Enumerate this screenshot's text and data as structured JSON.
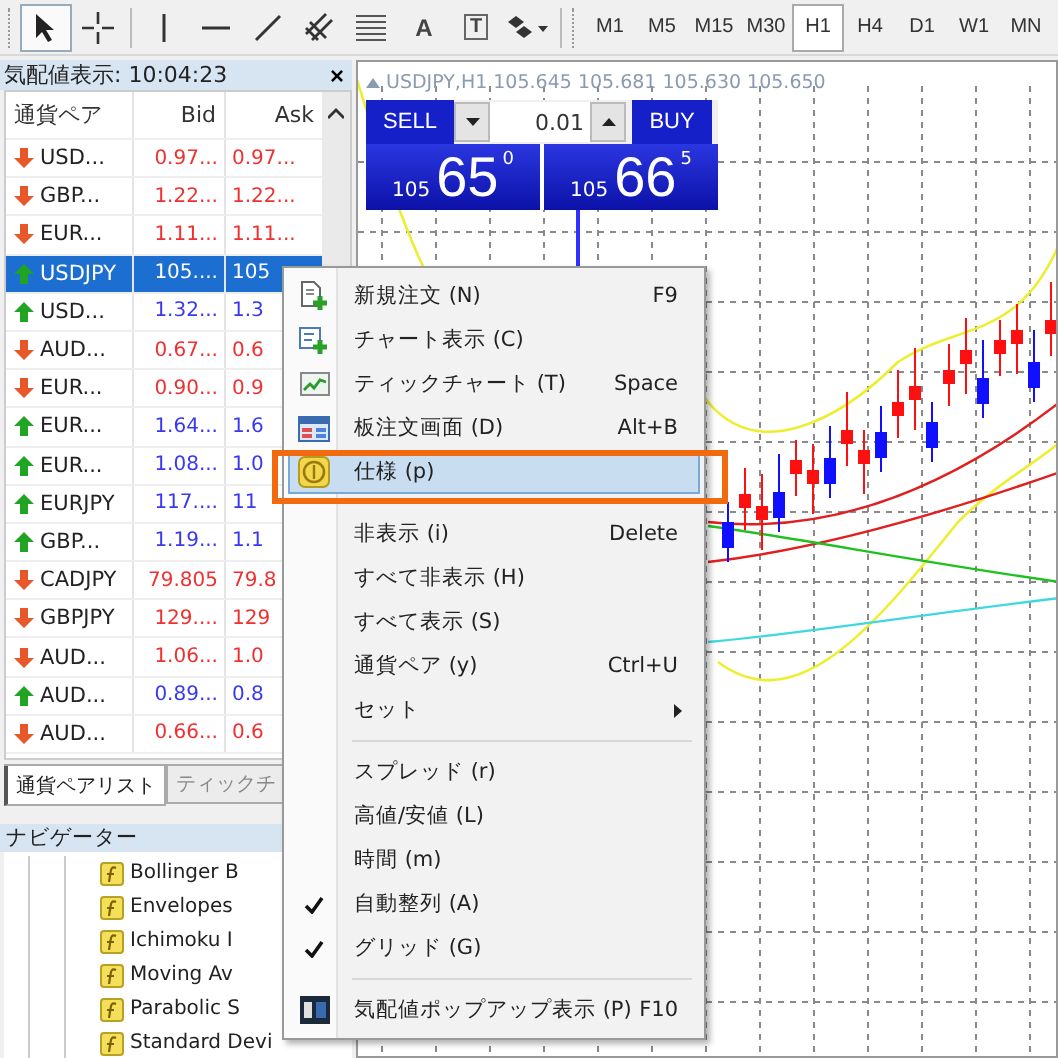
{
  "toolbar": {
    "tools": [
      {
        "kind": "cursor",
        "selected": true
      },
      {
        "kind": "crosshair",
        "selected": false
      },
      {
        "kind": "vline",
        "selected": false
      },
      {
        "kind": "hline",
        "selected": false
      },
      {
        "kind": "trendline",
        "selected": false
      },
      {
        "kind": "channel",
        "selected": false
      },
      {
        "kind": "fibo",
        "selected": false
      },
      {
        "kind": "text",
        "label": "A",
        "selected": false
      },
      {
        "kind": "label",
        "label": "T",
        "selected": false
      },
      {
        "kind": "shapes",
        "selected": false
      }
    ],
    "timeframes": [
      {
        "label": "M1",
        "selected": false
      },
      {
        "label": "M5",
        "selected": false
      },
      {
        "label": "M15",
        "selected": false
      },
      {
        "label": "M30",
        "selected": false
      },
      {
        "label": "H1",
        "selected": true
      },
      {
        "label": "H4",
        "selected": false
      },
      {
        "label": "D1",
        "selected": false
      },
      {
        "label": "W1",
        "selected": false
      },
      {
        "label": "MN",
        "selected": false
      }
    ]
  },
  "market_watch": {
    "title": "気配値表示: 10:04:23",
    "close": "×",
    "columns": [
      "通貨ペア",
      "Bid",
      "Ask"
    ],
    "rows": [
      {
        "symbol": "USD...",
        "bid": "0.97...",
        "ask": "0.97...",
        "up": false,
        "selected": false
      },
      {
        "symbol": "GBP...",
        "bid": "1.22...",
        "ask": "1.22...",
        "up": false,
        "selected": false
      },
      {
        "symbol": "EUR...",
        "bid": "1.11...",
        "ask": "1.11...",
        "up": false,
        "selected": false
      },
      {
        "symbol": "USDJPY",
        "bid": "105....",
        "ask": "105",
        "up": true,
        "selected": true
      },
      {
        "symbol": "USD...",
        "bid": "1.32...",
        "ask": "1.3",
        "up": true,
        "selected": false
      },
      {
        "symbol": "AUD...",
        "bid": "0.67...",
        "ask": "0.6",
        "up": false,
        "selected": false
      },
      {
        "symbol": "EUR...",
        "bid": "0.90...",
        "ask": "0.9",
        "up": false,
        "selected": false
      },
      {
        "symbol": "EUR...",
        "bid": "1.64...",
        "ask": "1.6",
        "up": true,
        "selected": false
      },
      {
        "symbol": "EUR...",
        "bid": "1.08...",
        "ask": "1.0",
        "up": true,
        "selected": false
      },
      {
        "symbol": "EURJPY",
        "bid": "117....",
        "ask": "11",
        "up": true,
        "selected": false
      },
      {
        "symbol": "GBP...",
        "bid": "1.19...",
        "ask": "1.1",
        "up": true,
        "selected": false
      },
      {
        "symbol": "CADJPY",
        "bid": "79.805",
        "ask": "79.8",
        "up": false,
        "selected": false
      },
      {
        "symbol": "GBPJPY",
        "bid": "129....",
        "ask": "129",
        "up": false,
        "selected": false
      },
      {
        "symbol": "AUD...",
        "bid": "1.06...",
        "ask": "1.0",
        "up": false,
        "selected": false
      },
      {
        "symbol": "AUD...",
        "bid": "0.89...",
        "ask": "0.8",
        "up": true,
        "selected": false
      },
      {
        "symbol": "AUD...",
        "bid": "0.66...",
        "ask": "0.6",
        "up": false,
        "selected": false
      }
    ],
    "tabs": [
      {
        "label": "通貨ペアリスト",
        "selected": true
      },
      {
        "label": "ティックチ",
        "selected": false
      }
    ]
  },
  "navigator": {
    "title": "ナビゲーター",
    "items": [
      "Bollinger B",
      "Envelopes",
      "Ichimoku I",
      "Moving Av",
      "Parabolic S",
      "Standard Devi"
    ]
  },
  "chart": {
    "title": "USDJPY,H1",
    "ohlc": "105.645 105.681 105.630 105.650",
    "trade_panel": {
      "sell": "SELL",
      "buy": "BUY",
      "lot": "0.01",
      "sell_price": {
        "big": "105",
        "main": "65",
        "small": "0"
      },
      "buy_price": {
        "big": "105",
        "main": "66",
        "small": "5"
      }
    }
  },
  "context_menu": {
    "items": [
      {
        "kind": "item",
        "label": "新規注文 (N)",
        "shortcut": "F9",
        "checked": false,
        "selected": false,
        "submenu": false
      },
      {
        "kind": "item",
        "label": "チャート表示 (C)",
        "checked": false,
        "selected": false,
        "submenu": false
      },
      {
        "kind": "item",
        "label": "ティックチャート (T)",
        "shortcut": "Space",
        "checked": false,
        "selected": false,
        "submenu": false
      },
      {
        "kind": "item",
        "label": "板注文画面 (D)",
        "shortcut": "Alt+B",
        "checked": false,
        "selected": false,
        "submenu": false
      },
      {
        "kind": "item",
        "label": "仕様 (p)",
        "checked": false,
        "selected": true,
        "submenu": false
      },
      {
        "kind": "separator"
      },
      {
        "kind": "item",
        "label": "非表示 (i)",
        "shortcut": "Delete",
        "checked": false,
        "selected": false,
        "submenu": false
      },
      {
        "kind": "item",
        "label": "すべて非表示 (H)",
        "checked": false,
        "selected": false,
        "submenu": false
      },
      {
        "kind": "item",
        "label": "すべて表示 (S)",
        "checked": false,
        "selected": false,
        "submenu": false
      },
      {
        "kind": "item",
        "label": "通貨ペア (y)",
        "shortcut": "Ctrl+U",
        "checked": false,
        "selected": false,
        "submenu": false
      },
      {
        "kind": "item",
        "label": "セット",
        "checked": false,
        "selected": false,
        "submenu": true
      },
      {
        "kind": "separator"
      },
      {
        "kind": "item",
        "label": "スプレッド (r)",
        "checked": false,
        "selected": false,
        "submenu": false
      },
      {
        "kind": "item",
        "label": "高値/安値 (L)",
        "checked": false,
        "selected": false,
        "submenu": false
      },
      {
        "kind": "item",
        "label": "時間 (m)",
        "checked": false,
        "selected": false,
        "submenu": false
      },
      {
        "kind": "item",
        "label": "自動整列 (A)",
        "checked": true,
        "selected": false,
        "submenu": false
      },
      {
        "kind": "item",
        "label": "グリッド (G)",
        "checked": true,
        "selected": false,
        "submenu": false
      },
      {
        "kind": "separator"
      },
      {
        "kind": "item",
        "label": "気配値ポップアップ表示 (P)",
        "shortcut": "F10",
        "checked": false,
        "selected": false,
        "submenu": false
      }
    ]
  }
}
